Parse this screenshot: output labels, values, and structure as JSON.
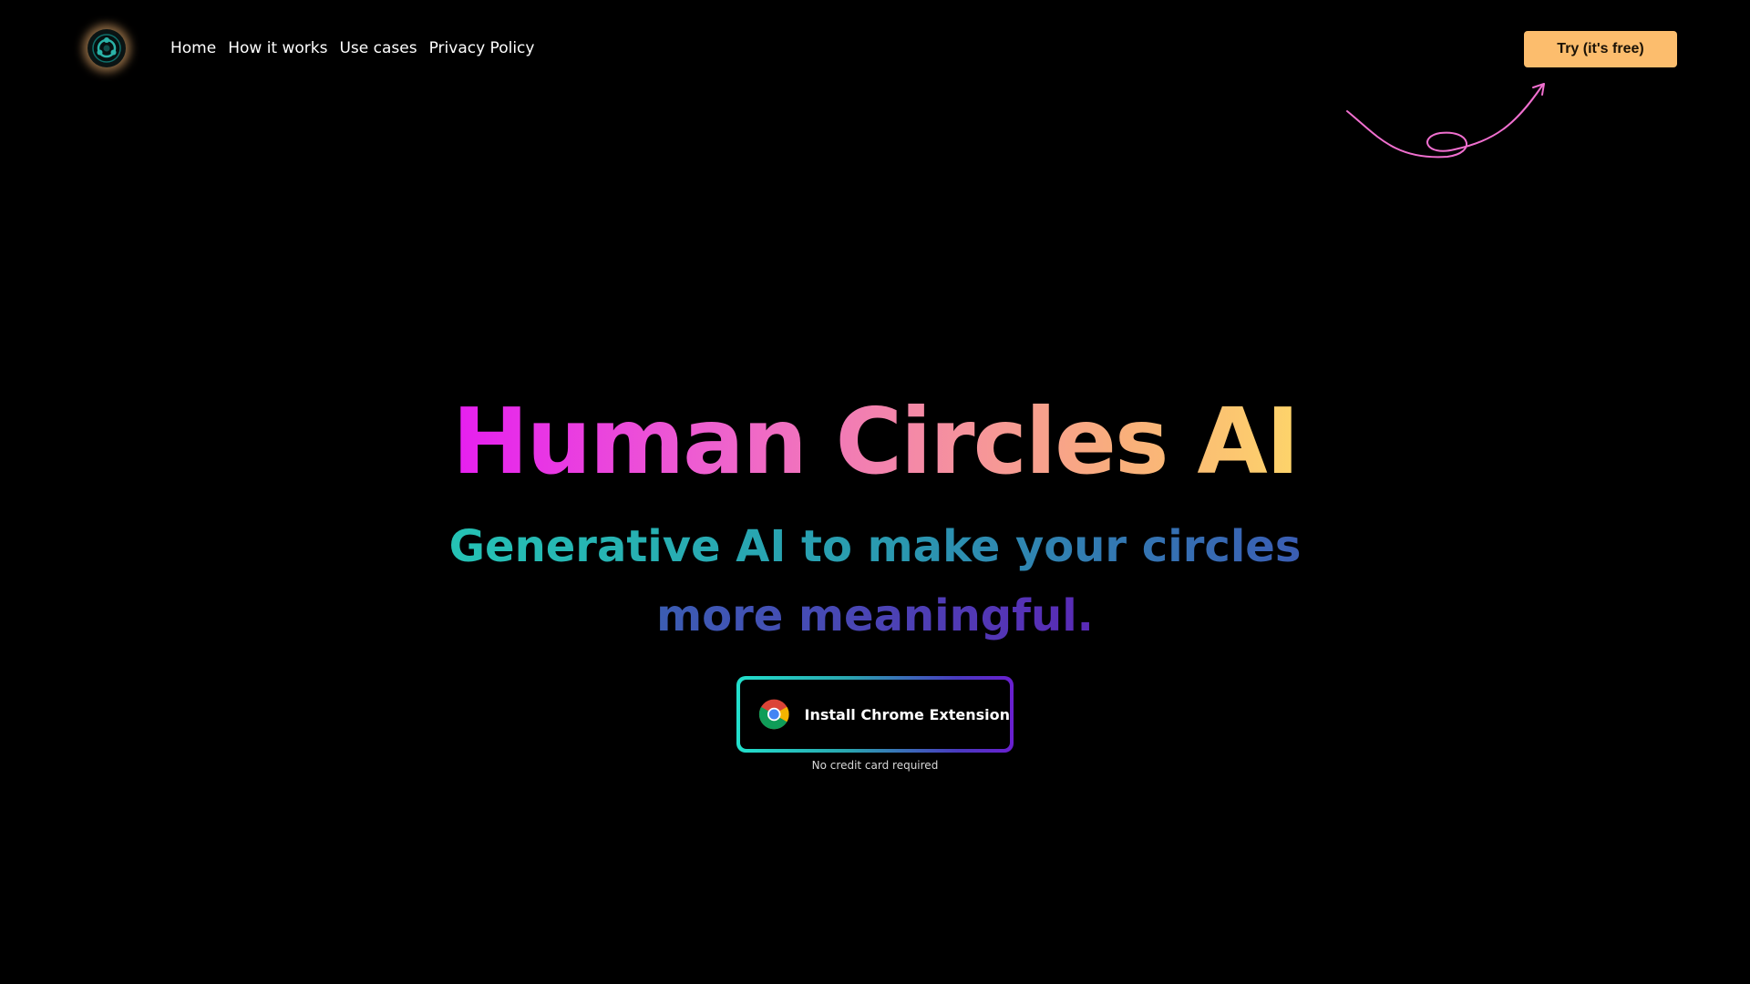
{
  "header": {
    "logo_icon": "circles-logo-icon",
    "nav": [
      {
        "label": "Home"
      },
      {
        "label": "How it works"
      },
      {
        "label": "Use cases"
      },
      {
        "label": "Privacy Policy"
      }
    ],
    "cta_label": "Try (it's free)",
    "cta_color": "#fcbd6d"
  },
  "hero": {
    "title": "Human Circles AI",
    "subtitle": "Generative AI to make your circles more meaningful.",
    "install_label": "Install Chrome Extension",
    "install_icon": "chrome-icon",
    "note": "No credit card required"
  },
  "colors": {
    "background": "#000000",
    "arrow": "#f06fcf"
  }
}
